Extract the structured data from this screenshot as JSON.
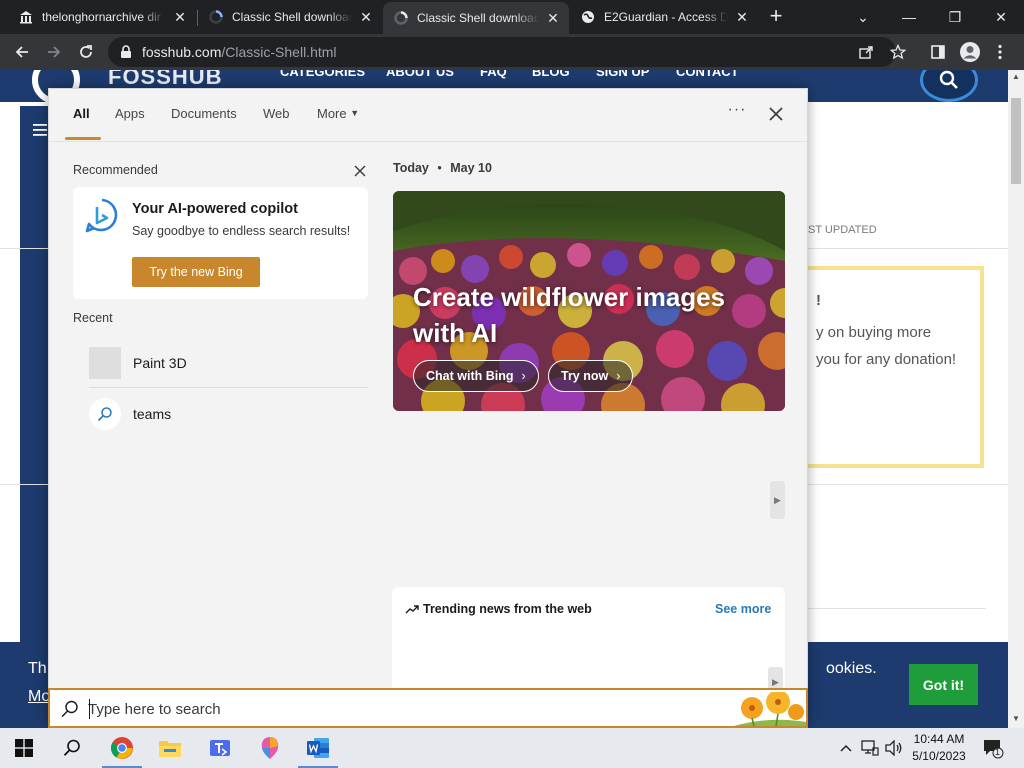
{
  "browser": {
    "tabs": [
      {
        "title": "thelonghornarchive dir",
        "favicon": "building-icon",
        "active": false
      },
      {
        "title": "Classic Shell download",
        "favicon": "fosshub-ring-icon",
        "active": false
      },
      {
        "title": "Classic Shell download",
        "favicon": "fosshub-ring-icon",
        "active": true
      },
      {
        "title": "E2Guardian - Access De",
        "favicon": "globe-icon",
        "active": false
      }
    ],
    "address_bar": {
      "host": "fosshub.com",
      "path": "/Classic-Shell.html"
    }
  },
  "background_page": {
    "logo_text": "FOSSHUB",
    "nav": [
      "CATEGORIES",
      "ABOUT US",
      "FAQ",
      "BLOG",
      "SIGN UP",
      "CONTACT"
    ],
    "last_updated": "ST UPDATED",
    "donate_lines": [
      "!",
      "y on buying more",
      "you for any donation!"
    ],
    "cookie_text_left": "Th",
    "cookie_text_left2": "Mo",
    "cookie_text_right": "ookies.",
    "cookie_button": "Got it!"
  },
  "search_flyout": {
    "tabs": [
      "All",
      "Apps",
      "Documents",
      "Web",
      "More"
    ],
    "active_tab": "All",
    "recommended_title": "Recommended",
    "bing_card": {
      "title": "Your AI-powered copilot",
      "subtitle": "Say goodbye to endless search results!",
      "button": "Try the new Bing"
    },
    "recent_title": "Recent",
    "recent_items": [
      {
        "label": "Paint 3D",
        "icon": "paint3d-icon"
      },
      {
        "label": "teams",
        "icon": "search-icon"
      }
    ],
    "today_label": "Today",
    "today_date": "May 10",
    "hero": {
      "title": "Create wildflower images with AI",
      "buttons": [
        "Chat with Bing",
        "Try now"
      ]
    },
    "trending": {
      "title": "Trending news from the web",
      "see_more": "See more"
    },
    "search_placeholder": "Type here to search"
  },
  "taskbar": {
    "apps": [
      "start-icon",
      "search-icon",
      "chrome-icon",
      "file-explorer-icon",
      "teams-icon",
      "paint3d-icon",
      "word-icon"
    ],
    "time": "10:44 AM",
    "date": "5/10/2023",
    "notification_count": "1"
  },
  "colors": {
    "accent": "#c8872c",
    "fosshub_blue": "#1d3b6e",
    "got_it_green": "#1e9d3a",
    "link_blue": "#2a7ab8"
  }
}
